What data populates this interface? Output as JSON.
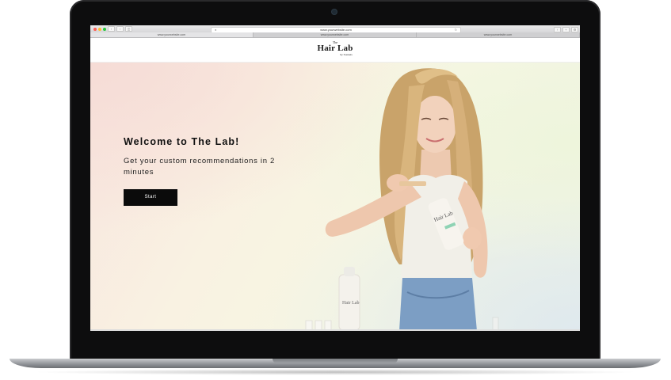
{
  "browser": {
    "url": "www.yourwebsite.com",
    "tabs": [
      "www.yourwebsite.com",
      "www.yourwebsite.com",
      "www.yourwebsite.com"
    ]
  },
  "site": {
    "logo": {
      "the": "The",
      "name": "Hair Lab",
      "by": "by Sonnets"
    }
  },
  "hero": {
    "title": "Welcome to The Lab!",
    "subtitle": "Get your custom recommendations in 2 minutes",
    "cta_label": "Start"
  },
  "product": {
    "bottle_label": "Hair Lab"
  },
  "icons": [
    "lock-icon",
    "reload-icon",
    "share-icon",
    "new-tab-icon",
    "settings-icon"
  ],
  "colors": {
    "laptop_bezel": "#0d0d0e",
    "cta_background": "#0b0b0b",
    "cta_text": "#ffffff",
    "hero_pink": "#f6dcd6",
    "hero_green": "#eef5dc",
    "hero_blue": "#dfe9ee"
  }
}
